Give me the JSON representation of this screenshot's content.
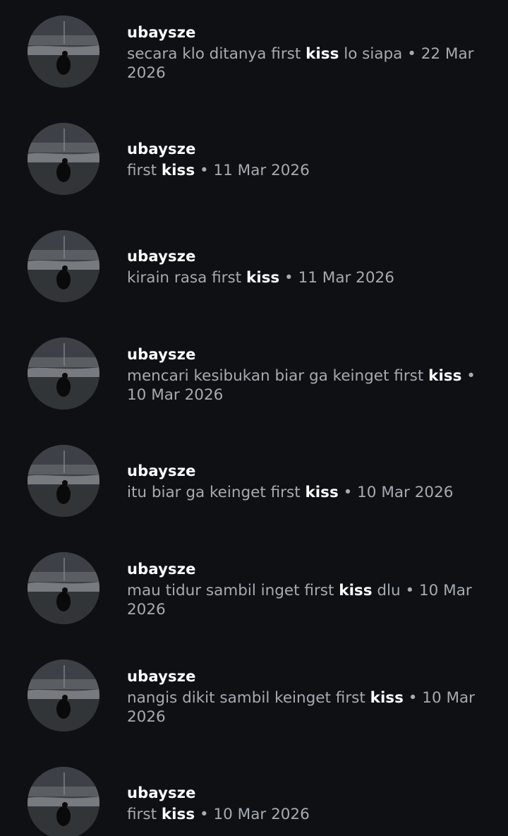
{
  "results": [
    {
      "username": "ubaysze",
      "before": "secara klo ditanya first ",
      "keyword": "kiss",
      "after": " lo siapa",
      "separator": " • ",
      "date": "22 Mar 2026"
    },
    {
      "username": "ubaysze",
      "before": "first ",
      "keyword": "kiss",
      "after": "",
      "separator": " • ",
      "date": "11 Mar 2026"
    },
    {
      "username": "ubaysze",
      "before": "kirain rasa first ",
      "keyword": "kiss",
      "after": "",
      "separator": " • ",
      "date": "11 Mar 2026"
    },
    {
      "username": "ubaysze",
      "before": "mencari kesibukan biar ga keinget first ",
      "keyword": "kiss",
      "after": "",
      "separator": " • ",
      "date": "10 Mar 2026"
    },
    {
      "username": "ubaysze",
      "before": "itu biar ga keinget first ",
      "keyword": "kiss",
      "after": "",
      "separator": " • ",
      "date": "10 Mar 2026"
    },
    {
      "username": "ubaysze",
      "before": "mau tidur sambil inget first ",
      "keyword": "kiss",
      "after": " dlu",
      "separator": " • ",
      "date": "10 Mar 2026"
    },
    {
      "username": "ubaysze",
      "before": "nangis dikit sambil keinget first ",
      "keyword": "kiss",
      "after": "",
      "separator": " • ",
      "date": "10 Mar 2026"
    },
    {
      "username": "ubaysze",
      "before": "first ",
      "keyword": "kiss",
      "after": "",
      "separator": " • ",
      "date": "10 Mar 2026"
    }
  ]
}
